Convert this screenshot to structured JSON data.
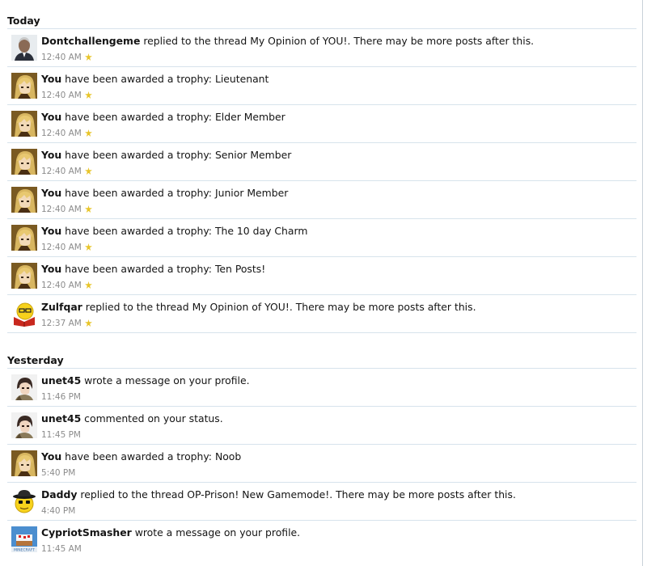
{
  "sections": [
    {
      "heading": "Today",
      "items": [
        {
          "avatar": "portrait-avatar",
          "user": "Dontchallengeme",
          "action": "replied to the thread",
          "link": "My Opinion of YOU!",
          "trail": ". There may be more posts after this.",
          "time": "12:40 AM",
          "new": true
        },
        {
          "avatar": "anime-blonde-avatar",
          "user": "You",
          "action": "have been awarded a trophy:",
          "link": "Lieutenant",
          "trail": "",
          "time": "12:40 AM",
          "new": true
        },
        {
          "avatar": "anime-blonde-avatar",
          "user": "You",
          "action": "have been awarded a trophy:",
          "link": "Elder Member",
          "trail": "",
          "time": "12:40 AM",
          "new": true
        },
        {
          "avatar": "anime-blonde-avatar",
          "user": "You",
          "action": "have been awarded a trophy:",
          "link": "Senior Member",
          "trail": "",
          "time": "12:40 AM",
          "new": true
        },
        {
          "avatar": "anime-blonde-avatar",
          "user": "You",
          "action": "have been awarded a trophy:",
          "link": "Junior Member",
          "trail": "",
          "time": "12:40 AM",
          "new": true
        },
        {
          "avatar": "anime-blonde-avatar",
          "user": "You",
          "action": "have been awarded a trophy:",
          "link": "The 10 day Charm",
          "trail": "",
          "time": "12:40 AM",
          "new": true
        },
        {
          "avatar": "anime-blonde-avatar",
          "user": "You",
          "action": "have been awarded a trophy:",
          "link": "Ten Posts!",
          "trail": "",
          "time": "12:40 AM",
          "new": true
        },
        {
          "avatar": "reading-smiley-avatar",
          "user": "Zulfqar",
          "action": "replied to the thread",
          "link": "My Opinion of YOU!",
          "trail": ". There may be more posts after this.",
          "time": "12:37 AM",
          "new": true
        }
      ]
    },
    {
      "heading": "Yesterday",
      "items": [
        {
          "avatar": "anime-dark-hair-avatar",
          "user": "unet45",
          "action": "wrote a message on",
          "link": "your profile",
          "trail": ".",
          "time": "11:46 PM",
          "new": false
        },
        {
          "avatar": "anime-dark-hair-avatar",
          "user": "unet45",
          "action": "commented on",
          "link": "your status",
          "trail": ".",
          "time": "11:45 PM",
          "new": false
        },
        {
          "avatar": "anime-blonde-avatar",
          "user": "You",
          "action": "have been awarded a trophy:",
          "link": "Noob",
          "trail": "",
          "time": "5:40 PM",
          "new": false
        },
        {
          "avatar": "hat-smiley-avatar",
          "user": "Daddy",
          "action": "replied to the thread",
          "link": "OP-Prison! New Gamemode!",
          "trail": ". There may be more posts after this.",
          "time": "4:40 PM",
          "new": false
        },
        {
          "avatar": "minecraft-cake-avatar",
          "user": "CypriotSmasher",
          "action": "wrote a message on",
          "link": "your profile",
          "trail": ".",
          "time": "11:45 AM",
          "new": false
        }
      ]
    }
  ],
  "icons": {
    "new": "new-star-icon"
  },
  "colors": {
    "new_star": "#e8c52a",
    "divider": "#d7e3ec",
    "timestamp": "#8c8c8c"
  }
}
